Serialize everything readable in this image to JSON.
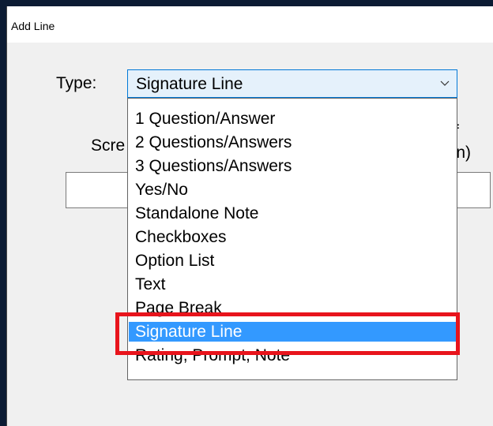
{
  "dialog": {
    "title": "Add Line",
    "type_label": "Type:",
    "screen_label": "Scre",
    "right_label_line1": "y if",
    "right_label_line2": "een)",
    "selected_type": "Signature Line"
  },
  "dropdown": {
    "options": [
      "1 Question/Answer",
      "2 Questions/Answers",
      "3 Questions/Answers",
      "Yes/No",
      "Standalone Note",
      "Checkboxes",
      "Option List",
      "Text",
      "Page Break",
      "Signature Line",
      "Rating, Prompt, Note"
    ],
    "selected_index": 9
  },
  "colors": {
    "selection": "#3399ff",
    "highlight_box": "#e8141c",
    "combo_focus": "#0078d7"
  },
  "icons": {
    "combo_arrow": "chevron-down-icon"
  }
}
